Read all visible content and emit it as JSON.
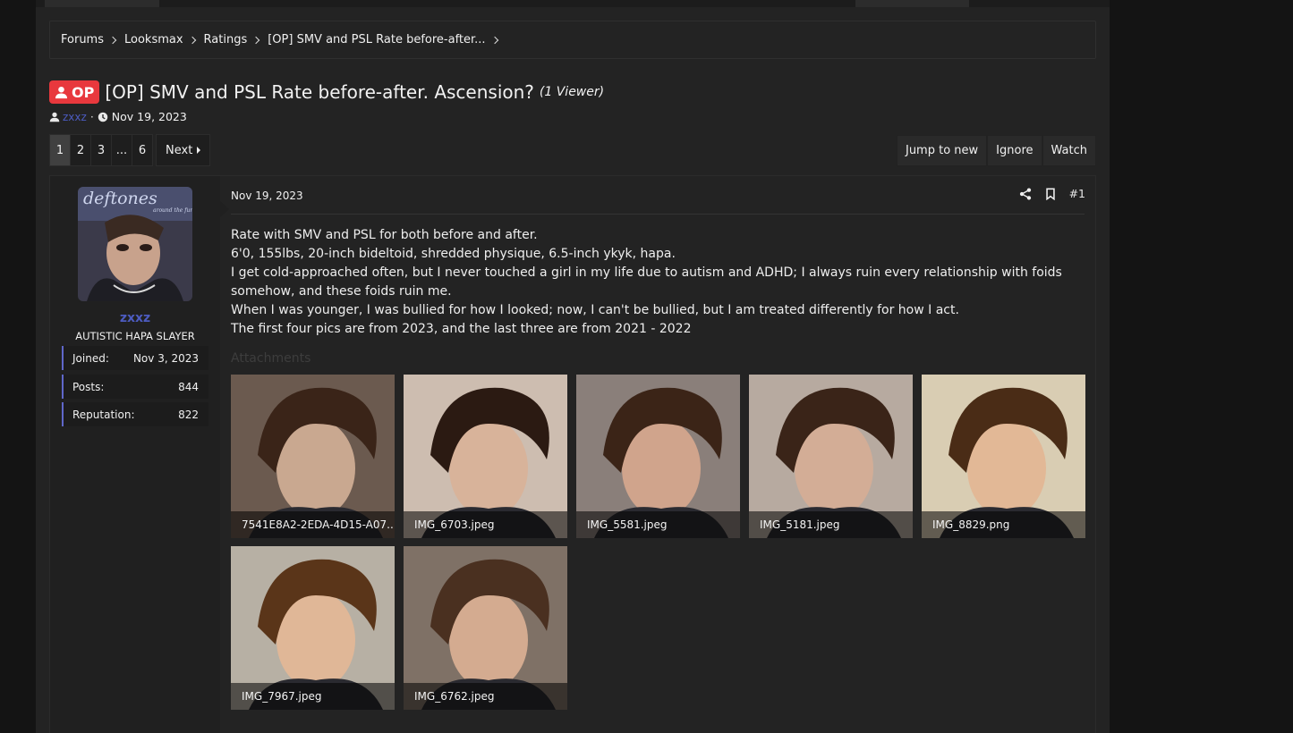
{
  "breadcrumb": {
    "items": [
      "Forums",
      "Looksmax",
      "Ratings",
      "[OP] SMV and PSL Rate before-after..."
    ]
  },
  "thread": {
    "badge": "OP",
    "title": "[OP] SMV and PSL Rate before-after. Ascension?",
    "viewers": "(1 Viewer)",
    "author": "zxxz",
    "separator": "·",
    "date": "Nov 19, 2023"
  },
  "pagination": {
    "pages": [
      "1",
      "2",
      "3",
      "...",
      "6"
    ],
    "current": "1",
    "next_label": "Next"
  },
  "thread_actions": {
    "jump_to_new": "Jump to new",
    "ignore": "Ignore",
    "watch": "Watch"
  },
  "post": {
    "user": {
      "name": "zxxz",
      "title": "AUTISTIC HAPA SLAYER",
      "avatar_icon": "album-cover-avatar",
      "stats": [
        {
          "label": "Joined:",
          "value": "Nov 3, 2023"
        },
        {
          "label": "Posts:",
          "value": "844"
        },
        {
          "label": "Reputation:",
          "value": "822"
        }
      ]
    },
    "date": "Nov 19, 2023",
    "number": "#1",
    "body": [
      "Rate with SMV and PSL for both before and after.",
      "6'0, 155lbs, 20-inch bideltoid, shredded physique, 6.5-inch ykyk, hapa.",
      "I get cold-approached often, but I never touched a girl in my life due to autism and ADHD; I always ruin every relationship with foids somehow, and these foids ruin me.",
      "When I was younger, I was bullied for how I looked; now, I can't be bullied, but I am treated differently for how I act.",
      "The first four pics are from 2023, and the last three are from 2021 - 2022"
    ],
    "attachments_label": "Attachments",
    "attachments": [
      {
        "name": "7541E8A2-2EDA-4D15-A07...",
        "bg": "#6b5a4f",
        "hair": "#3a2418",
        "skin": "#c9a890"
      },
      {
        "name": "IMG_6703.jpeg",
        "bg": "#cdbdb0",
        "hair": "#2b1a12",
        "skin": "#d8b39a"
      },
      {
        "name": "IMG_5581.jpeg",
        "bg": "#8a7f7a",
        "hair": "#3b2417",
        "skin": "#d0a48c"
      },
      {
        "name": "IMG_5181.jpeg",
        "bg": "#b7aaa0",
        "hair": "#3a2418",
        "skin": "#d3ad96"
      },
      {
        "name": "IMG_8829.png",
        "bg": "#d9cdb3",
        "hair": "#4a2c16",
        "skin": "#e2b896"
      },
      {
        "name": "IMG_7967.jpeg",
        "bg": "#b7b0a4",
        "hair": "#5a3519",
        "skin": "#e0b797"
      },
      {
        "name": "IMG_6762.jpeg",
        "bg": "#7f7166",
        "hair": "#4a3020",
        "skin": "#d4ab90"
      }
    ]
  },
  "colors": {
    "accent": "#e8383d",
    "username": "#4c5bbf",
    "stat_border": "#5f67c9"
  }
}
